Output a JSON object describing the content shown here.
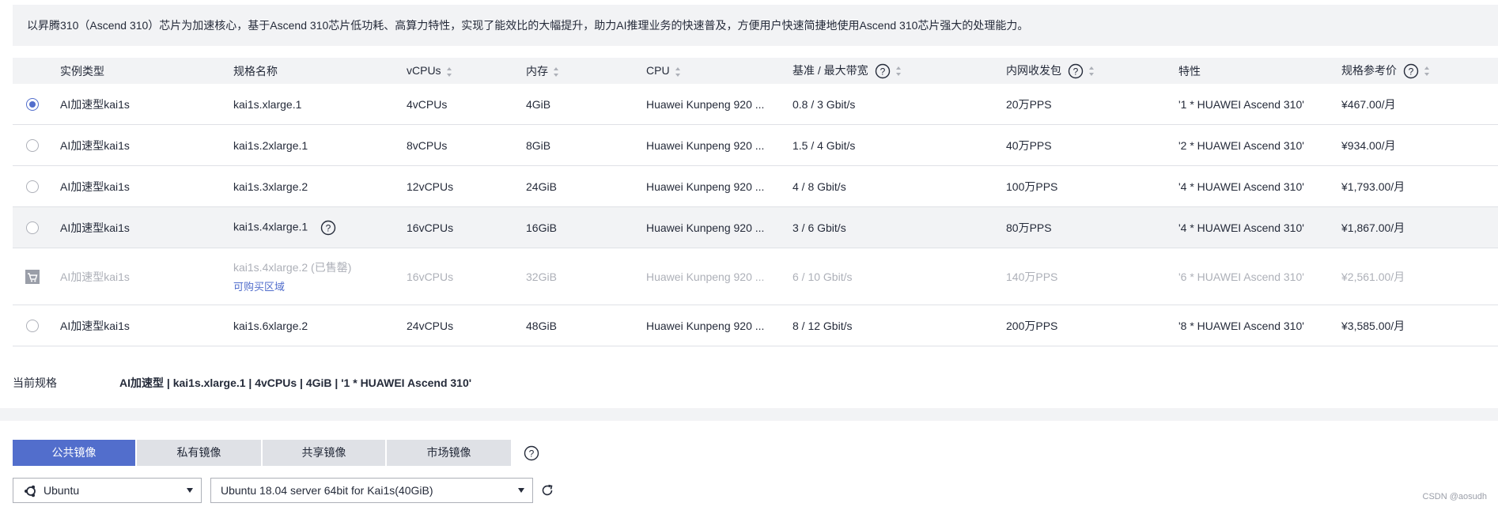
{
  "banner": {
    "text": "以昇腾310（Ascend 310）芯片为加速核心，基于Ascend 310芯片低功耗、高算力特性，实现了能效比的大幅提升，助力AI推理业务的快速普及，方便用户快速简捷地使用Ascend 310芯片强大的处理能力。"
  },
  "table": {
    "headers": {
      "type": "实例类型",
      "name": "规格名称",
      "vcpus": "vCPUs",
      "memory": "内存",
      "cpu": "CPU",
      "bandwidth": "基准 / 最大带宽",
      "pps": "内网收发包",
      "feature": "特性",
      "price": "规格参考价"
    },
    "rows": [
      {
        "type": "AI加速型kai1s",
        "name": "kai1s.xlarge.1",
        "vcpus": "4vCPUs",
        "memory": "4GiB",
        "cpu": "Huawei Kunpeng 920 ...",
        "bandwidth": "0.8 / 3 Gbit/s",
        "pps": "20万PPS",
        "feature": "'1 * HUAWEI Ascend 310'",
        "price": "¥467.00/月"
      },
      {
        "type": "AI加速型kai1s",
        "name": "kai1s.2xlarge.1",
        "vcpus": "8vCPUs",
        "memory": "8GiB",
        "cpu": "Huawei Kunpeng 920 ...",
        "bandwidth": "1.5 / 4 Gbit/s",
        "pps": "40万PPS",
        "feature": "'2 * HUAWEI Ascend 310'",
        "price": "¥934.00/月"
      },
      {
        "type": "AI加速型kai1s",
        "name": "kai1s.3xlarge.2",
        "vcpus": "12vCPUs",
        "memory": "24GiB",
        "cpu": "Huawei Kunpeng 920 ...",
        "bandwidth": "4 / 8 Gbit/s",
        "pps": "100万PPS",
        "feature": "'4 * HUAWEI Ascend 310'",
        "price": "¥1,793.00/月"
      },
      {
        "type": "AI加速型kai1s",
        "name": "kai1s.4xlarge.1",
        "vcpus": "16vCPUs",
        "memory": "16GiB",
        "cpu": "Huawei Kunpeng 920 ...",
        "bandwidth": "3 / 6 Gbit/s",
        "pps": "80万PPS",
        "feature": "'4 * HUAWEI Ascend 310'",
        "price": "¥1,867.00/月"
      },
      {
        "type": "AI加速型kai1s",
        "name": "kai1s.4xlarge.2 (已售罄)",
        "sub_link": "可购买区域",
        "vcpus": "16vCPUs",
        "memory": "32GiB",
        "cpu": "Huawei Kunpeng 920 ...",
        "bandwidth": "6 / 10 Gbit/s",
        "pps": "140万PPS",
        "feature": "'6 * HUAWEI Ascend 310'",
        "price": "¥2,561.00/月"
      },
      {
        "type": "AI加速型kai1s",
        "name": "kai1s.6xlarge.2",
        "vcpus": "24vCPUs",
        "memory": "48GiB",
        "cpu": "Huawei Kunpeng 920 ...",
        "bandwidth": "8 / 12 Gbit/s",
        "pps": "200万PPS",
        "feature": "'8 * HUAWEI Ascend 310'",
        "price": "¥3,585.00/月"
      }
    ]
  },
  "current_spec": {
    "label": "当前规格",
    "value": "AI加速型 | kai1s.xlarge.1 | 4vCPUs | 4GiB | '1 * HUAWEI Ascend 310'"
  },
  "image_tabs": [
    "公共镜像",
    "私有镜像",
    "共享镜像",
    "市场镜像"
  ],
  "os_select": {
    "value": "Ubuntu"
  },
  "image_select": {
    "value": "Ubuntu 18.04 server 64bit for Kai1s(40GiB)"
  },
  "watermark": "CSDN @aosudh",
  "colors": {
    "accent": "#526ecc",
    "header_bg": "#f2f3f5",
    "disabled_text": "#adb0b8"
  }
}
